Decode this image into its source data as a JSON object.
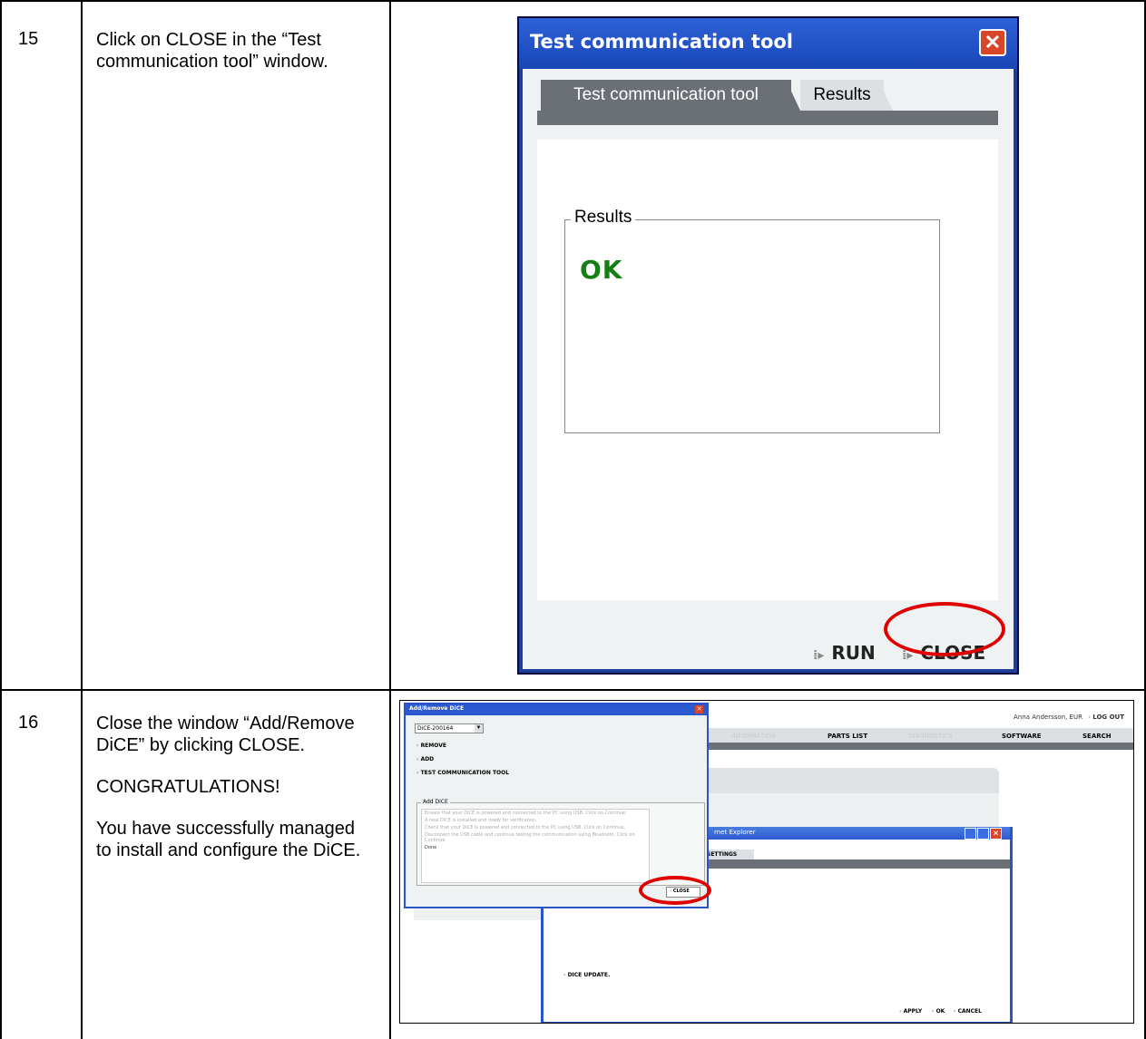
{
  "steps": [
    {
      "number": "15",
      "text": "Click on CLOSE in the “Test communication tool” window."
    },
    {
      "number": "16",
      "text": "Close the window “Add/Remove DiCE” by clicking CLOSE.",
      "congrats": "CONGRATULATIONS!",
      "success": "You have successfully managed to install and configure the DiCE."
    }
  ],
  "screenshot1": {
    "title": "Test communication tool",
    "tabs": [
      "Test communication tool",
      "Results"
    ],
    "group_label": "Results",
    "result": "OK",
    "buttons": {
      "run": "RUN",
      "close": "CLOSE"
    },
    "colors": {
      "title_bar": "#1f4fc4",
      "ok": "#147f14",
      "highlight": "#e00000",
      "close_btn": "#d8462a"
    }
  },
  "screenshot2": {
    "user": "Anna Andersson, EUR",
    "logout": "LOG OUT",
    "nav": [
      "INFORMATION",
      "PARTS LIST",
      "DIAGNOSTICS",
      "SOFTWARE",
      "SEARCH"
    ],
    "dialog_title": "Add/Remove DiCE",
    "dice_select": "DiCE-200164",
    "actions": [
      "REMOVE",
      "ADD",
      "TEST COMMUNICATION TOOL"
    ],
    "group_label": "Add DiCE",
    "log": [
      "Ensure that your DiCE is powered and connected to the PC using USB. Click on Continue.",
      "A new DiCE is installed and ready for verification.",
      "Check that your DiCE is powered and connected to the PC using USB. Click on Continue.",
      "Disconnect the USB cable and continue testing the communication using Bluetooth. Click on Continue.",
      "Done"
    ],
    "close": "CLOSE",
    "ie_title": "rnet Explorer",
    "settings_tab": "SETTINGS",
    "dice_update": "DICE UPDATE.",
    "bottom_buttons": [
      "APPLY",
      "OK",
      "CANCEL"
    ]
  }
}
